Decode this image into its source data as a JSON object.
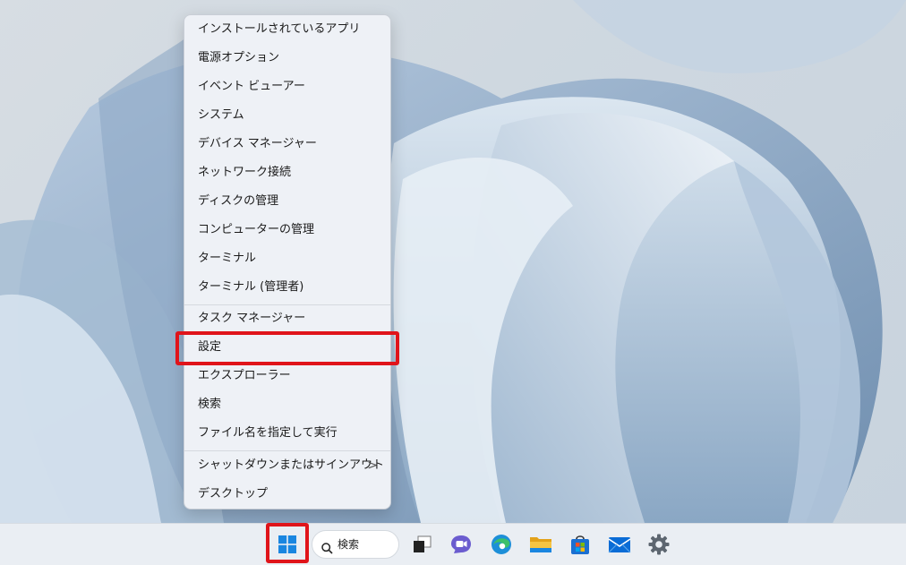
{
  "context_menu": {
    "items": [
      {
        "label": "インストールされているアプリ"
      },
      {
        "label": "電源オプション"
      },
      {
        "label": "イベント ビューアー"
      },
      {
        "label": "システム"
      },
      {
        "label": "デバイス マネージャー"
      },
      {
        "label": "ネットワーク接続"
      },
      {
        "label": "ディスクの管理"
      },
      {
        "label": "コンピューターの管理"
      },
      {
        "label": "ターミナル"
      },
      {
        "label": "ターミナル (管理者)"
      },
      {
        "label": "タスク マネージャー"
      },
      {
        "label": "設定"
      },
      {
        "label": "エクスプローラー"
      },
      {
        "label": "検索"
      },
      {
        "label": "ファイル名を指定して実行"
      },
      {
        "label": "シャットダウンまたはサインアウト",
        "submenu": ">"
      },
      {
        "label": "デスクトップ"
      }
    ],
    "highlighted_item": "設定"
  },
  "taskbar": {
    "search_label": "検索",
    "icons": [
      "windows-start-icon",
      "search-icon",
      "task-view-icon",
      "teams-chat-icon",
      "edge-icon",
      "file-explorer-icon",
      "microsoft-store-icon",
      "mail-icon",
      "settings-gear-icon"
    ]
  },
  "colors": {
    "highlight_box": "#e0141a",
    "windows_blue": "#0a6cd6"
  }
}
